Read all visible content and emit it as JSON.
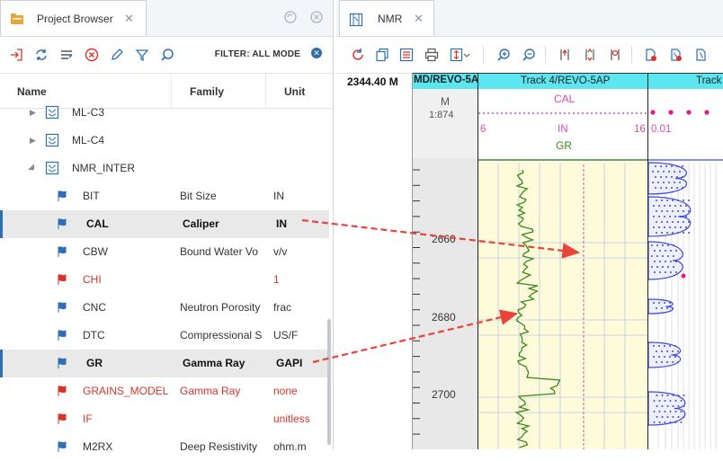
{
  "left_panel": {
    "tab_title": "Project Browser",
    "filter_label": "FILTER: ALL MODE",
    "columns": [
      "Name",
      "Family",
      "Unit"
    ],
    "groups": [
      "ML-C3",
      "ML-C4",
      "NMR_INTER"
    ],
    "rows": [
      {
        "name": "BIT",
        "family": "Bit Size",
        "unit": "IN",
        "state": "normal"
      },
      {
        "name": "CAL",
        "family": "Caliper",
        "unit": "IN",
        "state": "selected"
      },
      {
        "name": "CBW",
        "family": "Bound Water Vo",
        "unit": "v/v",
        "state": "normal"
      },
      {
        "name": "CHI",
        "family": "",
        "unit": "1",
        "state": "red"
      },
      {
        "name": "CNC",
        "family": "Neutron Porosity",
        "unit": "frac",
        "state": "normal"
      },
      {
        "name": "DTC",
        "family": "Compressional S",
        "unit": "US/F",
        "state": "normal"
      },
      {
        "name": "GR",
        "family": "Gamma Ray",
        "unit": "GAPI",
        "state": "selected"
      },
      {
        "name": "GRAINS_MODEL...",
        "family": "Gamma Ray",
        "unit": "none",
        "state": "red"
      },
      {
        "name": "IF",
        "family": "",
        "unit": "unitless",
        "state": "red"
      },
      {
        "name": "M2RX",
        "family": "Deep Resistivity",
        "unit": "ohm.m",
        "state": "normal"
      }
    ]
  },
  "right_panel": {
    "tab_title": "NMR",
    "depth_readout": "2344.40 M",
    "track_md": {
      "header": "MD/REVO-5A",
      "unit": "M",
      "scale": "1:874"
    },
    "track4": {
      "header": "Track 4/REVO-5AP",
      "cal_label": "CAL",
      "cal_left": "6",
      "cal_unit": "IN",
      "cal_right": "16",
      "gr_label": "GR"
    },
    "track5": {
      "header": "Track",
      "left_value": "0.01"
    },
    "depth_ticks": [
      "2660",
      "2680",
      "2700"
    ]
  },
  "colors": {
    "accent": "#2d6fb5",
    "track_header": "#5ce6f2",
    "curve_cal": "#d94fa8",
    "curve_gr": "#3a8a1f",
    "track_bg": "#fdfbd9",
    "annotation_arrow": "#e8443a",
    "error_text": "#d9342b"
  }
}
